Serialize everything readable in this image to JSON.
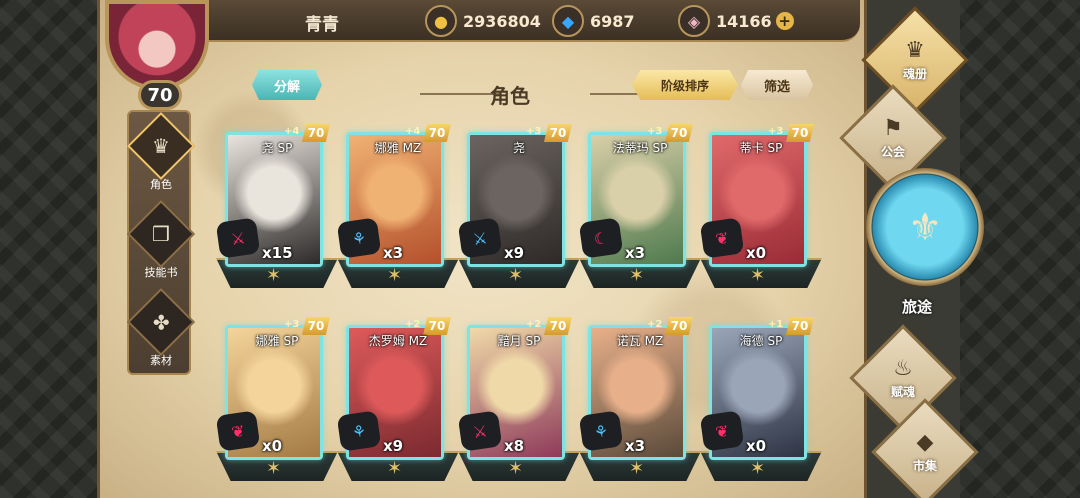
{
  "player": {
    "name": "青青",
    "level": "70"
  },
  "currencies": {
    "gold": {
      "icon": "gold-coin-icon",
      "value": "2936804"
    },
    "crystal": {
      "icon": "blue-crystal-icon",
      "value": "6987"
    },
    "gem": {
      "icon": "pink-gem-icon",
      "value": "14166"
    },
    "add_symbol": "+"
  },
  "left_menu": [
    {
      "label": "角色",
      "icon": "helmet-icon",
      "glyph": "♛",
      "active": true
    },
    {
      "label": "技能书",
      "icon": "skill-book-icon",
      "glyph": "❒",
      "active": false
    },
    {
      "label": "素材",
      "icon": "material-icon",
      "glyph": "✤",
      "active": false
    }
  ],
  "header": {
    "decompose": "分解",
    "title": "角色",
    "sort": "阶级排序",
    "filter": "筛选"
  },
  "cards": [
    {
      "name": "尧 SP",
      "plus": "+4",
      "level": "70",
      "count": "x15",
      "class": "red",
      "glyph": "⚔",
      "colors": [
        "#e9e4dc",
        "#2d2a2a"
      ]
    },
    {
      "name": "娜雅 MZ",
      "plus": "+4",
      "level": "70",
      "count": "x3",
      "class": "blue",
      "glyph": "⚘",
      "colors": [
        "#f0b273",
        "#b4502c"
      ]
    },
    {
      "name": "尧",
      "plus": "+3",
      "level": "70",
      "count": "x9",
      "class": "blue",
      "glyph": "⚔",
      "colors": [
        "#6b6460",
        "#2e2a28"
      ]
    },
    {
      "name": "法蒂玛 SP",
      "plus": "+3",
      "level": "70",
      "count": "x3",
      "class": "red",
      "glyph": "☾",
      "colors": [
        "#d9cfa8",
        "#4f7a4e"
      ]
    },
    {
      "name": "蒂卡 SP",
      "plus": "+3",
      "level": "70",
      "count": "x0",
      "class": "red",
      "glyph": "❦",
      "colors": [
        "#e06a6a",
        "#9a2b36"
      ]
    },
    {
      "name": "娜雅 SP",
      "plus": "+3",
      "level": "70",
      "count": "x0",
      "class": "red",
      "glyph": "❦",
      "colors": [
        "#f4d49a",
        "#a37a44"
      ]
    },
    {
      "name": "杰罗姆 MZ",
      "plus": "+2",
      "level": "70",
      "count": "x9",
      "class": "blue",
      "glyph": "⚘",
      "colors": [
        "#de5a5a",
        "#7a2a30"
      ]
    },
    {
      "name": "黯月 SP",
      "plus": "+2",
      "level": "70",
      "count": "x8",
      "class": "red",
      "glyph": "⚔",
      "colors": [
        "#f0d9a8",
        "#8e3a5a"
      ]
    },
    {
      "name": "诺瓦 MZ",
      "plus": "+2",
      "level": "70",
      "count": "x3",
      "class": "blue",
      "glyph": "⚘",
      "colors": [
        "#e8b08a",
        "#5a4a3a"
      ]
    },
    {
      "name": "海德 SP",
      "plus": "+1",
      "level": "70",
      "count": "x0",
      "class": "red",
      "glyph": "❦",
      "colors": [
        "#9aa6b8",
        "#2e3444"
      ]
    }
  ],
  "right_menu": [
    {
      "label": "魂册",
      "icon": "soul-book-icon",
      "glyph": "♛",
      "active": true
    },
    {
      "label": "公会",
      "icon": "guild-icon",
      "glyph": "⚑",
      "active": false
    },
    {
      "label": "旅途",
      "icon": "journey-emblem-icon",
      "glyph": "⚜"
    },
    {
      "label": "赋魂",
      "icon": "soul-flame-icon",
      "glyph": "♨",
      "active": false
    },
    {
      "label": "市集",
      "icon": "market-gem-icon",
      "glyph": "◆",
      "active": false
    }
  ]
}
